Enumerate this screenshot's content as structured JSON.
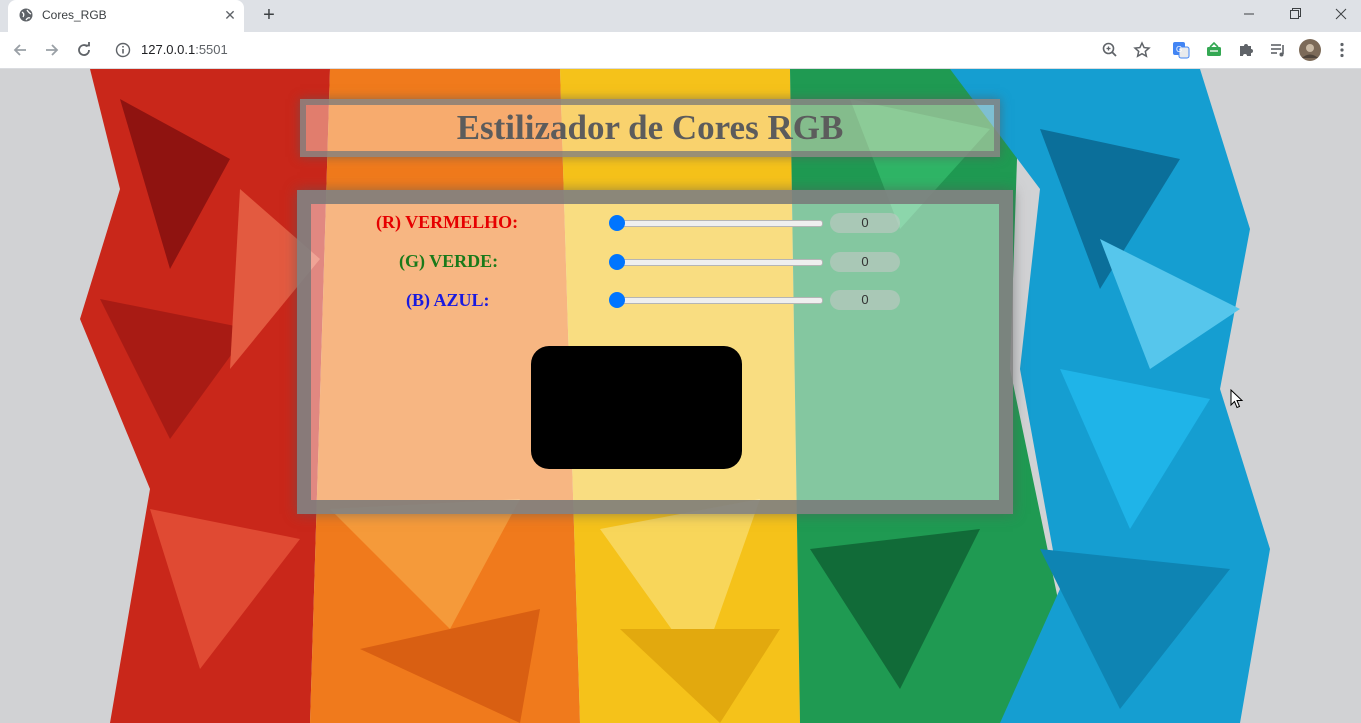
{
  "browser": {
    "tab_title": "Cores_RGB",
    "new_tab_symbol": "+",
    "close_symbol": "✕",
    "url_host": "127.0.0.1",
    "url_port": ":5501"
  },
  "page": {
    "heading": "Estilizador de Cores RGB",
    "channels": [
      {
        "label": "(R) VERMELHO:",
        "value": "0",
        "color": "#e60000"
      },
      {
        "label": "(G) VERDE:",
        "value": "0",
        "color": "#1a7a1a"
      },
      {
        "label": "(B) AZUL:",
        "value": "0",
        "color": "#1a1adf"
      }
    ],
    "preview_color": "#000000"
  },
  "colors": {
    "accent": "#0075ff",
    "bg_red": "#c9271a",
    "bg_orange": "#f07a1c",
    "bg_yellow": "#f5c21a",
    "bg_green": "#1f9a52",
    "bg_blue": "#159ed1"
  },
  "icons": [
    "globe-icon",
    "close-icon",
    "plus-icon",
    "back-icon",
    "forward-icon",
    "reload-icon",
    "info-icon",
    "zoom-icon",
    "star-icon",
    "translate-icon",
    "extension-icon",
    "puzzle-icon",
    "media-icon",
    "avatar",
    "menu-icon"
  ]
}
